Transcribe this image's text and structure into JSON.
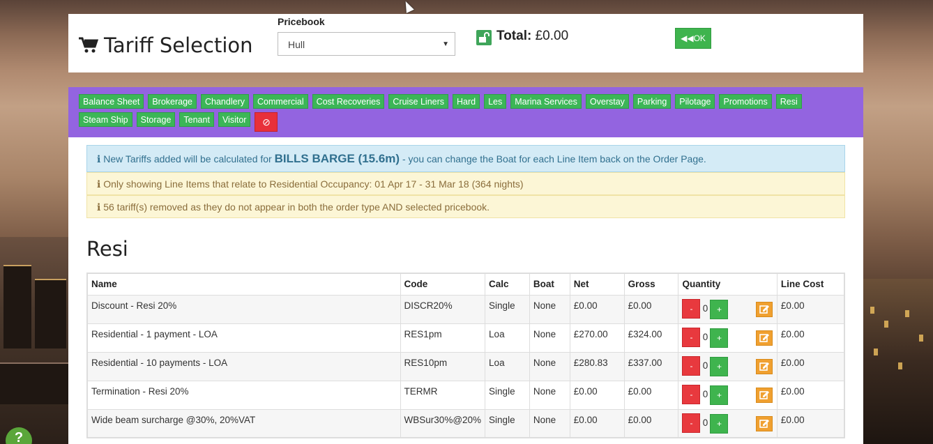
{
  "header": {
    "title": "Tariff Selection",
    "pricebook_label": "Pricebook",
    "pricebook_value": "Hull",
    "total_label": "Total:",
    "total_value": "£0.00",
    "ok_label": "OK"
  },
  "categories": [
    "Balance Sheet",
    "Brokerage",
    "Chandlery",
    "Commercial",
    "Cost Recoveries",
    "Cruise Liners",
    "Hard",
    "Les",
    "Marina Services",
    "Overstay",
    "Parking",
    "Pilotage",
    "Promotions",
    "Resi",
    "Steam Ship",
    "Storage",
    "Tenant",
    "Visitor"
  ],
  "alerts": {
    "info_prefix": "New Tariffs added will be calculated for",
    "info_boat": "BILLS BARGE (15.6m)",
    "info_suffix": "- you can change the Boat for each Line Item back on the Order Page.",
    "warn1": "Only showing Line Items that relate to Residential Occupancy: 01 Apr 17 - 31 Mar 18 (364 nights)",
    "warn2": "56 tariff(s) removed as they do not appear in both the order type AND selected pricebook."
  },
  "section_title": "Resi",
  "table": {
    "headers": [
      "Name",
      "Code",
      "Calc",
      "Boat",
      "Net",
      "Gross",
      "Quantity",
      "Line Cost"
    ],
    "rows": [
      {
        "name": "Discount - Resi 20%",
        "code": "DISCR20%",
        "calc": "Single",
        "boat": "None",
        "net": "£0.00",
        "gross": "£0.00",
        "qty": "0",
        "line_cost": "£0.00"
      },
      {
        "name": "Residential - 1 payment - LOA",
        "code": "RES1pm",
        "calc": "Loa",
        "boat": "None",
        "net": "£270.00",
        "gross": "£324.00",
        "qty": "0",
        "line_cost": "£0.00"
      },
      {
        "name": "Residential - 10 payments - LOA",
        "code": "RES10pm",
        "calc": "Loa",
        "boat": "None",
        "net": "£280.83",
        "gross": "£337.00",
        "qty": "0",
        "line_cost": "£0.00"
      },
      {
        "name": "Termination - Resi 20%",
        "code": "TERMR",
        "calc": "Single",
        "boat": "None",
        "net": "£0.00",
        "gross": "£0.00",
        "qty": "0",
        "line_cost": "£0.00"
      },
      {
        "name": "Wide beam surcharge @30%, 20%VAT",
        "code": "WBSur30%@20%",
        "calc": "Single",
        "boat": "None",
        "net": "£0.00",
        "gross": "£0.00",
        "qty": "0",
        "line_cost": "£0.00"
      }
    ]
  },
  "buttons": {
    "minus": "-",
    "plus": "+"
  },
  "help_label": "?"
}
